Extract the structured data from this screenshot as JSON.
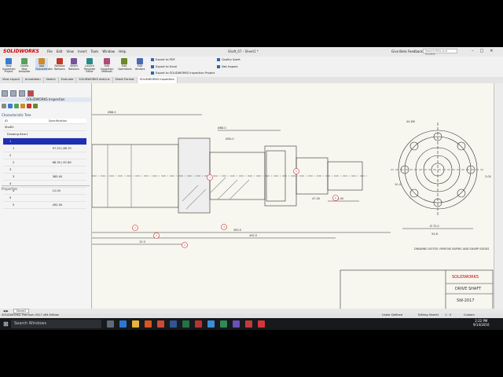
{
  "app": {
    "logo": "SOLIDWORKS",
    "title": "Shaft_07 - Sheet1 *",
    "feedback": "Give Beta Feedback",
    "search_placeholder": "Search files and models"
  },
  "menus": [
    "File",
    "Edit",
    "View",
    "Insert",
    "Tools",
    "Window",
    "Help"
  ],
  "ribbon": {
    "buttons": [
      {
        "label": "New Inspection Project",
        "color": "#3a7bd5"
      },
      {
        "label": "Create New template",
        "color": "#5aa05a"
      },
      {
        "label": "Add Characteristic",
        "color": "#d08a2a"
      },
      {
        "label": "Remove Balloons",
        "color": "#c0392b"
      },
      {
        "label": "Select Balloons",
        "color": "#7a52a0"
      },
      {
        "label": "Launch Template Editor",
        "color": "#2a8a8a"
      },
      {
        "label": "Edit Inspection Methods",
        "color": "#b04a7a"
      },
      {
        "label": "Edit Operations",
        "color": "#6a8a2a"
      },
      {
        "label": "Edit Vendors",
        "color": "#4a6ab0"
      }
    ],
    "links": [
      "Export to PDF",
      "Export to Excel",
      "Export to SOLIDWORKS Inspection Project",
      "Quality Xpert",
      "Net-Inspect"
    ]
  },
  "tabs": [
    "View Layout",
    "Annotation",
    "Sketch",
    "Evaluate",
    "SOLIDWORKS Add-Ins",
    "Sheet Format",
    "SOLIDWORKS Inspection"
  ],
  "active_tab": "SOLIDWORKS Inspection",
  "panel": {
    "title": "SOLIDWORKS Inspection",
    "tree_label": "Characteristic Tree",
    "headers": [
      "ID",
      "Specification"
    ],
    "root": "Shaft1",
    "group": "Drawing Item1",
    "rows": [
      {
        "id": "1",
        "spec": "",
        "selected": true
      },
      {
        "id": "1",
        "spec": "97.20 | 86.70"
      },
      {
        "id": "2",
        "spec": ""
      },
      {
        "id": "2",
        "spec": "68.30 | 67.80"
      },
      {
        "id": "3",
        "spec": ""
      },
      {
        "id": "3",
        "spec": "383.00"
      },
      {
        "id": "4",
        "spec": ""
      },
      {
        "id": "4",
        "spec": "12.00"
      },
      {
        "id": "5",
        "spec": ""
      },
      {
        "id": "5",
        "spec": "492.00"
      }
    ],
    "properties_label": "Properties"
  },
  "drawing": {
    "dims": [
      "Ø88.0",
      "Ø68.0",
      "Ø50.0",
      "4X Ø8",
      "383.0",
      "12.0",
      "492.0",
      "47.00",
      "45.00",
      "Ø 75.0",
      "54.6",
      "10.4",
      "3.00"
    ],
    "balloons": [
      "1",
      "2",
      "3",
      "4",
      "5",
      "6",
      "7",
      "8",
      "9",
      "10",
      "11",
      "12"
    ],
    "title_block": {
      "brand": "SOLIDWORKS",
      "name": "DRIVE SHAFT",
      "number": "SW-2017",
      "note": "DRAWING NOTES: REMOVE BURRS AND SHARP EDGES"
    }
  },
  "sheet_tab": "Sheet1",
  "status": {
    "left": "SOLIDWORKS Premium 2017 x64 Edition",
    "right1": "Under Defined",
    "right2": "Editing Sheet1",
    "right3": "1 : 5",
    "right4": "Custom"
  },
  "taskbar": {
    "search": "Search Windows",
    "time": "2:22 PM",
    "date": "9/14/2016"
  }
}
